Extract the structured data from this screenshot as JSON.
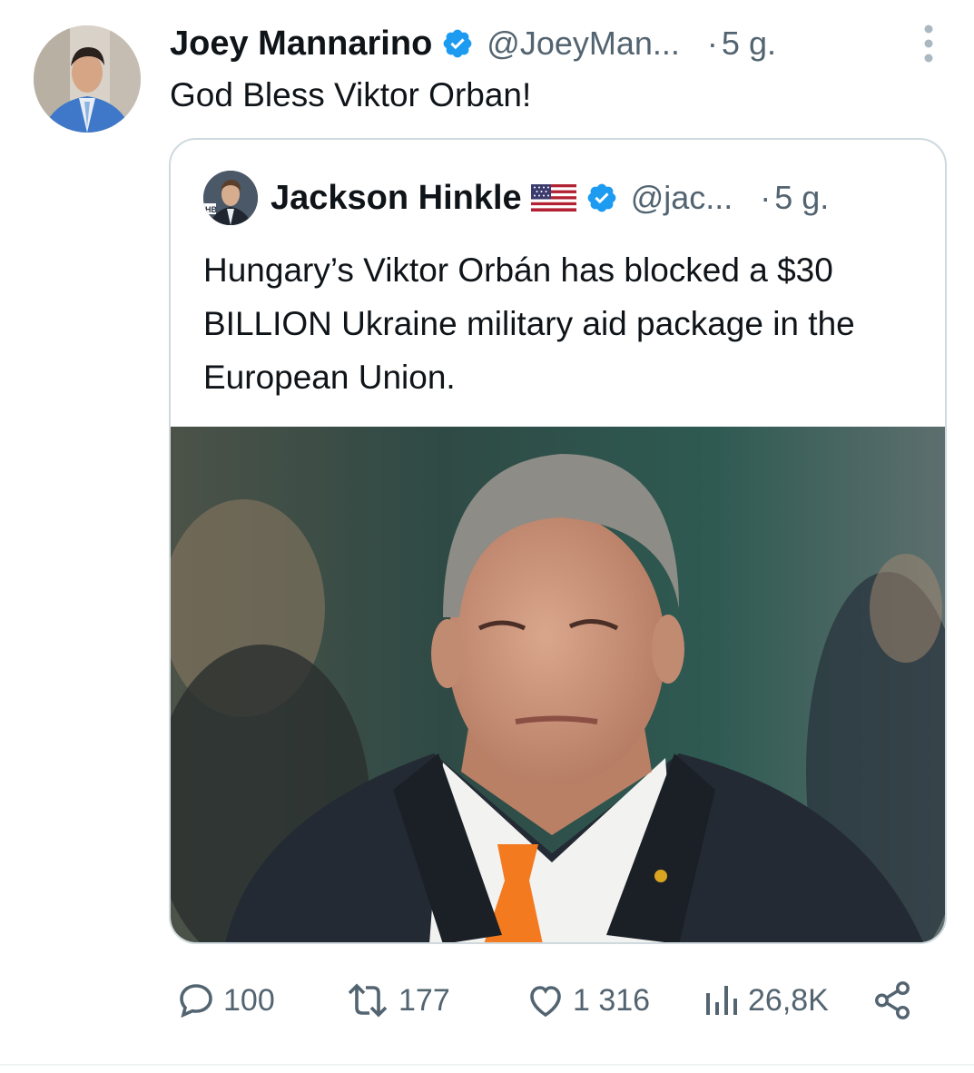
{
  "tweet": {
    "author_name": "Joey Mannarino",
    "handle": "@JoeyMan...",
    "separator": "·",
    "time": "5 g.",
    "text": "God Bless Viktor Orban!",
    "avatar_icon": "profile-photo"
  },
  "quote": {
    "author_name": "Jackson Hinkle",
    "handle": "@jac...",
    "separator": "·",
    "time": "5 g.",
    "text": "Hungary’s Viktor Orbán has blocked a $30 BILLION Ukraine military aid package in the European Union.",
    "flag_icon": "us-flag-icon"
  },
  "actions": {
    "replies": "100",
    "reposts": "177",
    "likes": "1 316",
    "views": "26,8K"
  },
  "colors": {
    "verified_blue": "#1d9bf0",
    "text_primary": "#0f1419",
    "text_secondary": "#536471",
    "border": "#cfd9de",
    "tie_orange": "#f47a1f"
  }
}
